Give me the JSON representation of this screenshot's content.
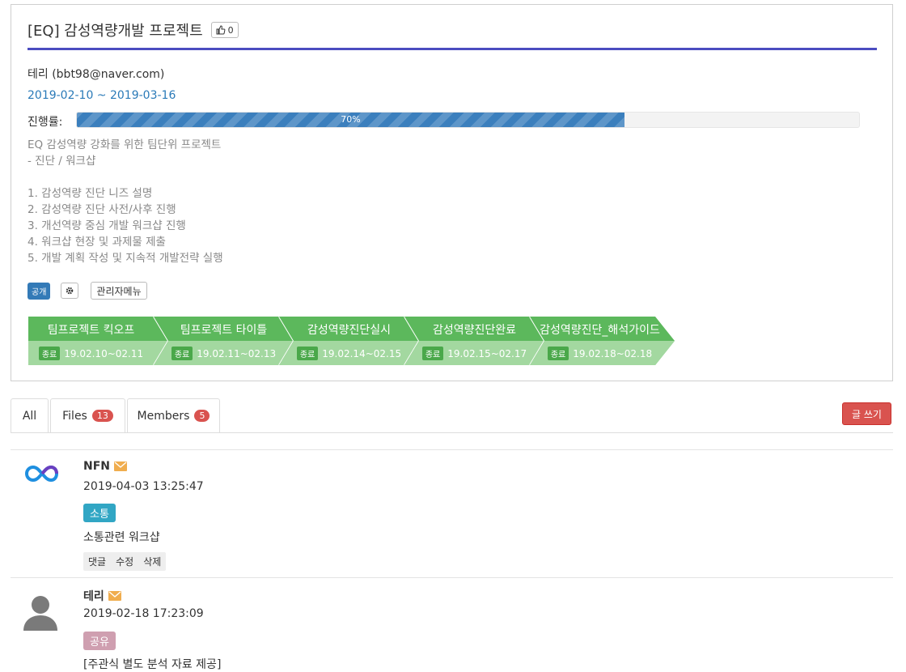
{
  "project": {
    "title": "[EQ] 감성역량개발 프로젝트",
    "like_count": "0",
    "owner": "테리 (bbt98@naver.com)",
    "dates": "2019-02-10 ~ 2019-03-16",
    "progress_label": "진행률:",
    "progress_value": 0.7,
    "progress_text": "70%",
    "description": [
      "EQ 감성역량 강화를 위한 팀단위 프로젝트",
      "- 진단 / 워크샵",
      "",
      "1. 감성역량 진단 니즈 설명",
      "2. 감성역량 진단 사전/사후 진행",
      "3. 개선역량 중심 개발 워크샵 진행",
      "4. 워크샵 현장 및 과제물 제출",
      "5. 개발 계획 작성 및 지속적 개발전략 실행"
    ],
    "visibility_tag": "공개",
    "admin_menu_label": "관리자메뉴",
    "colors": {
      "title_underline": "#4b4cc0",
      "stage_top": "#5cb85c",
      "stage_bottom": "#a3d8a0",
      "progress": "#3b7fbd"
    }
  },
  "stages": [
    {
      "name": "팀프로젝트 킥오프",
      "status": "종료",
      "period": "19.02.10~02.11"
    },
    {
      "name": "팀프로젝트 타이틀",
      "status": "종료",
      "period": "19.02.11~02.13"
    },
    {
      "name": "감성역량진단실시",
      "status": "종료",
      "period": "19.02.14~02.15"
    },
    {
      "name": "감성역량진단완료",
      "status": "종료",
      "period": "19.02.15~02.17"
    },
    {
      "name": "감성역량진단_해석가이드",
      "status": "종료",
      "period": "19.02.18~02.18"
    }
  ],
  "tabs": [
    {
      "label": "All",
      "count": null
    },
    {
      "label": "Files",
      "count": "13"
    },
    {
      "label": "Members",
      "count": "5"
    }
  ],
  "write_button": "글 쓰기",
  "posts": [
    {
      "author": "NFN",
      "time": "2019-04-03 13:25:47",
      "category": "소통",
      "category_color": "#31a6c4",
      "text": "소통관련 워크샵",
      "actions": [
        "댓글",
        "수정",
        "삭제"
      ]
    },
    {
      "author": "테리",
      "time": "2019-02-18 17:23:09",
      "category": "공유",
      "category_color": "#cf9fb0",
      "text": "[주관식 별도 분석 자료 제공]"
    }
  ]
}
